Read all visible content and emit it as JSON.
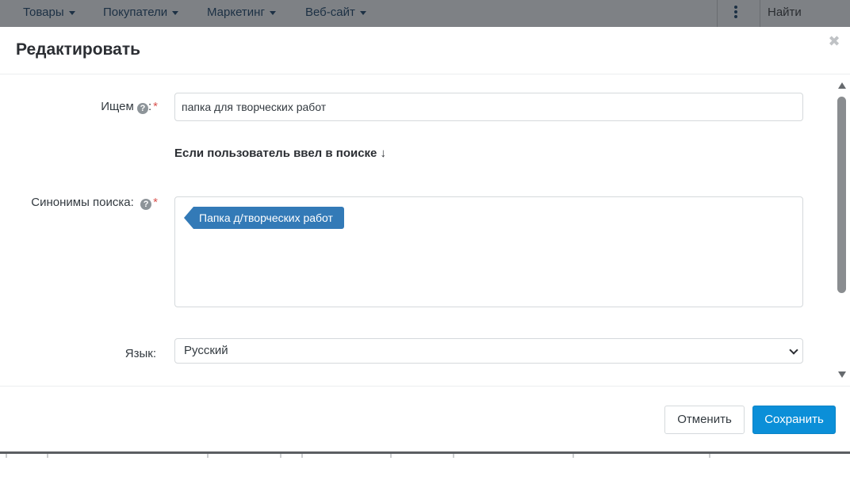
{
  "topnav": {
    "menus": [
      "Товары",
      "Покупатели",
      "Маркетинг",
      "Веб-сайт"
    ],
    "search_label": "Найти"
  },
  "modal": {
    "title": "Редактировать",
    "fields": {
      "query": {
        "label": "Ищем",
        "colon": ":",
        "required_mark": "*",
        "value": "папка для творческих работ"
      },
      "subheading": "Если пользователь ввел в поиске ↓",
      "synonyms": {
        "label": "Синонимы поиска:",
        "required_mark": "*",
        "tags": [
          "Папка д/творческих работ"
        ]
      },
      "language": {
        "label": "Язык:",
        "selected": "Русский"
      }
    },
    "footer": {
      "cancel_label": "Отменить",
      "save_label": "Сохранить"
    }
  },
  "colors": {
    "primary": "#0b8fd8",
    "tag": "#337ab7",
    "required": "#d9534f",
    "nav_overlay": "#7e8185"
  }
}
